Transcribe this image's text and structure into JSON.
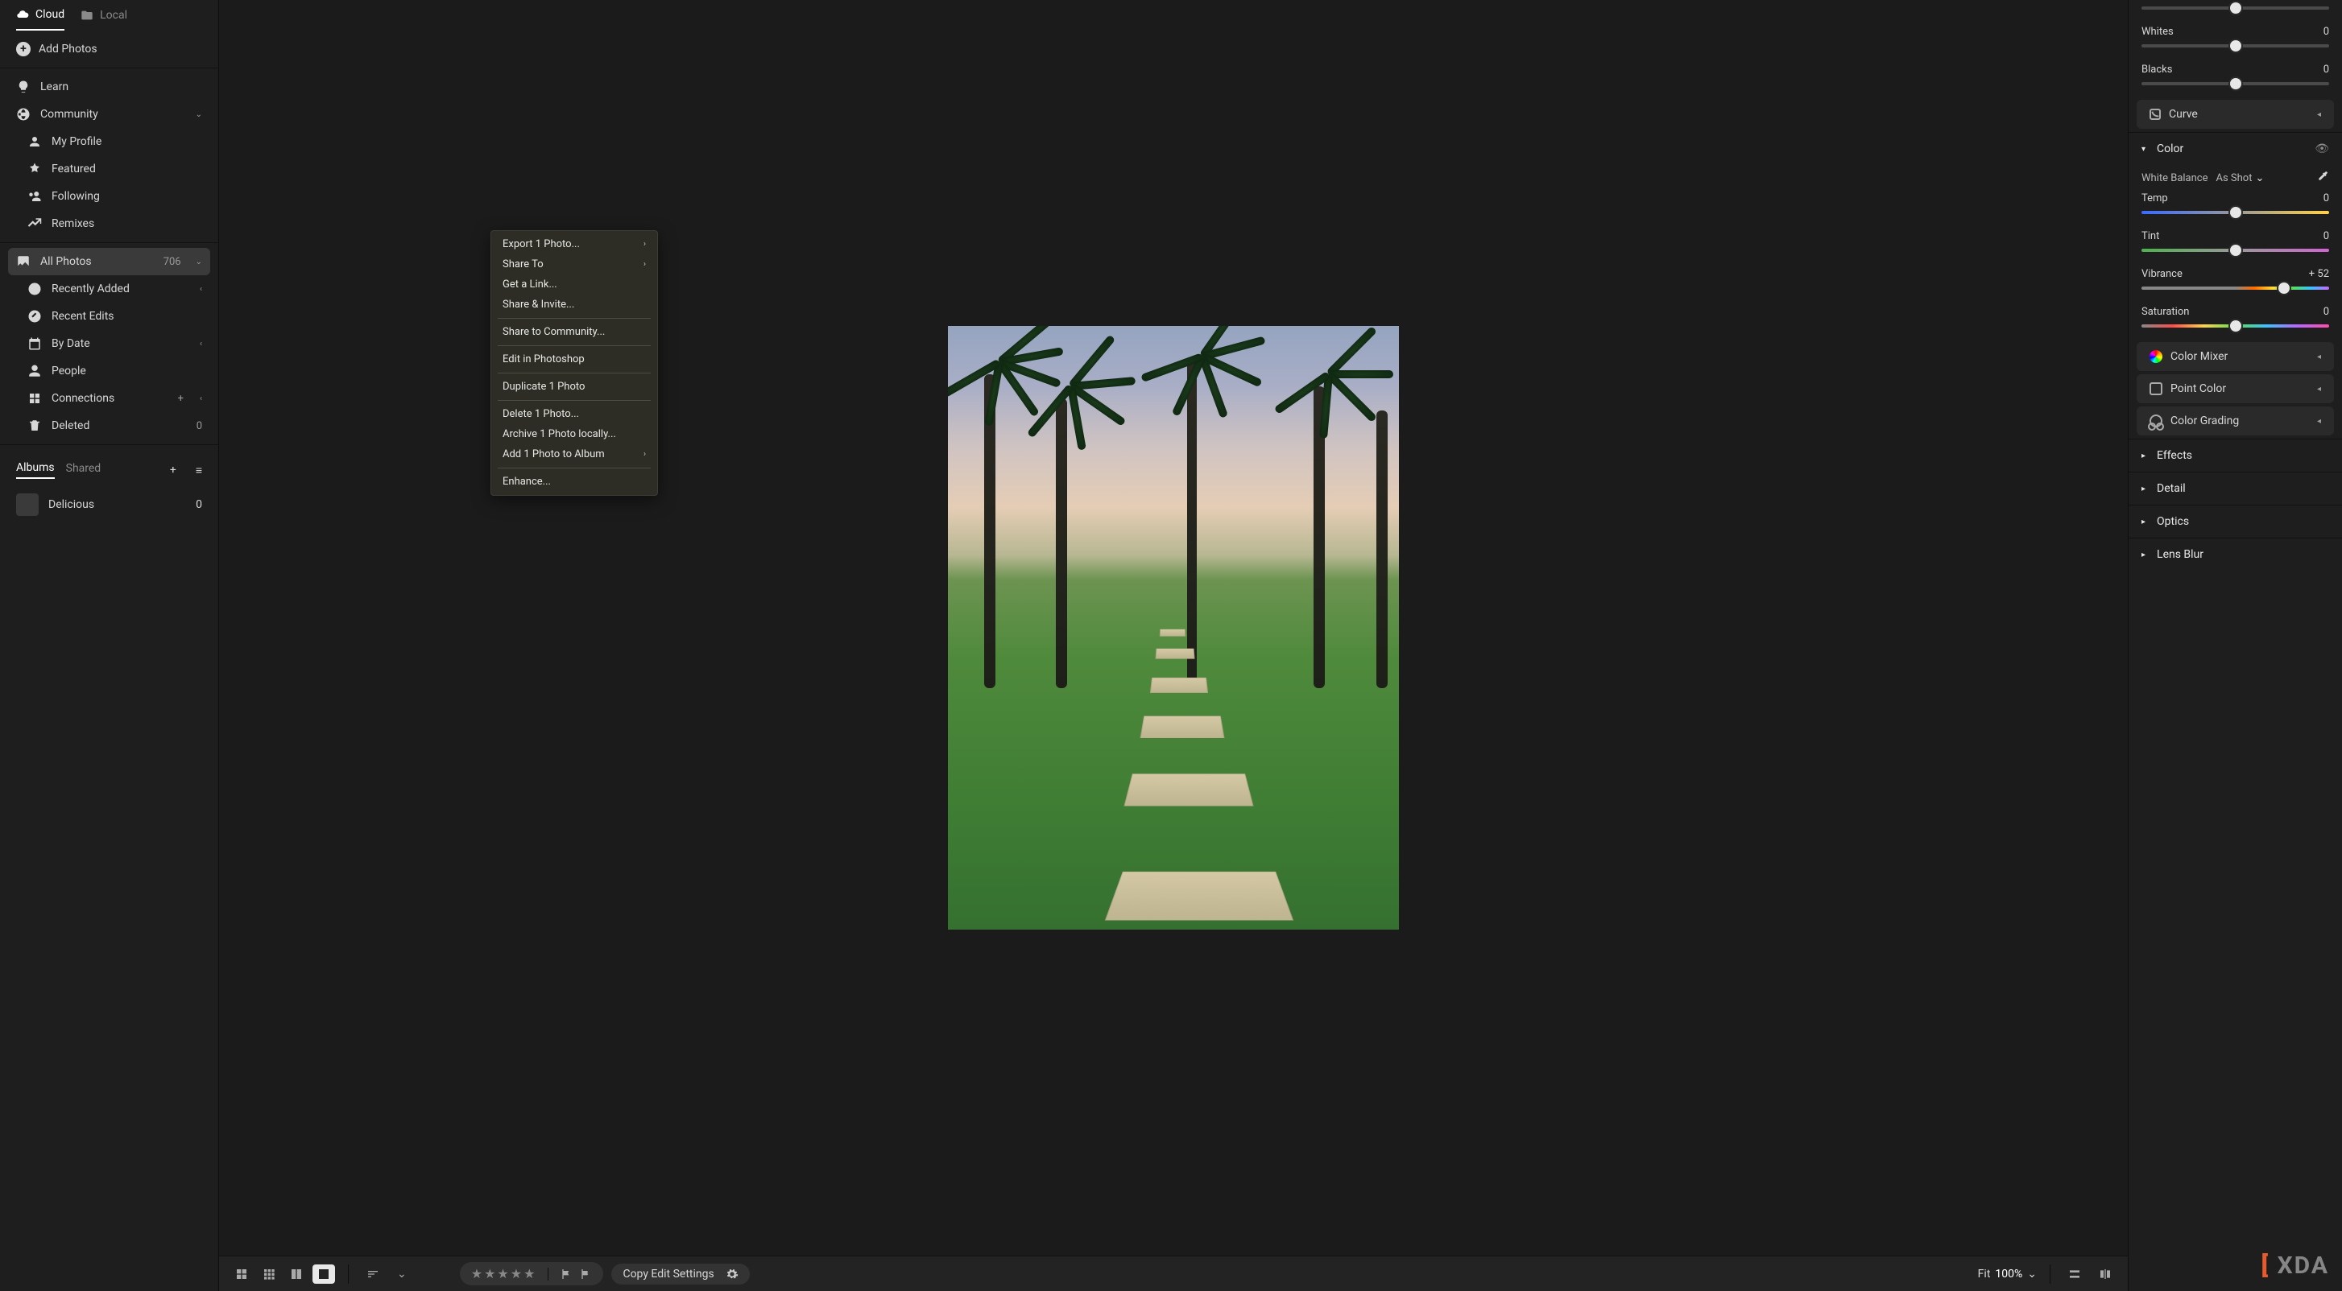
{
  "tabs": {
    "cloud": "Cloud",
    "local": "Local"
  },
  "add_photos": "Add Photos",
  "nav": {
    "learn": "Learn",
    "community": "Community",
    "my_profile": "My Profile",
    "featured": "Featured",
    "following": "Following",
    "remixes": "Remixes"
  },
  "library": {
    "all_photos": {
      "label": "All Photos",
      "count": "706"
    },
    "recently_added": "Recently Added",
    "recent_edits": "Recent Edits",
    "by_date": "By Date",
    "people": "People",
    "connections": "Connections",
    "deleted": {
      "label": "Deleted",
      "count": "0"
    }
  },
  "albums": {
    "tab_albums": "Albums",
    "tab_shared": "Shared",
    "items": [
      {
        "name": "Delicious",
        "count": "0"
      }
    ]
  },
  "context_menu": {
    "export": "Export 1 Photo...",
    "share_to": "Share To",
    "get_link": "Get a Link...",
    "share_invite": "Share & Invite...",
    "share_community": "Share to Community...",
    "edit_ps": "Edit in Photoshop",
    "duplicate": "Duplicate 1 Photo",
    "delete": "Delete 1 Photo...",
    "archive": "Archive 1 Photo locally...",
    "add_album": "Add 1 Photo to Album",
    "enhance": "Enhance..."
  },
  "bottombar": {
    "copy_edit": "Copy Edit Settings",
    "fit_label": "Fit",
    "zoom": "100%"
  },
  "right": {
    "whites": {
      "label": "Whites",
      "value": "0",
      "pos": 50
    },
    "blacks": {
      "label": "Blacks",
      "value": "0",
      "pos": 50
    },
    "curve": "Curve",
    "color_header": "Color",
    "wb_label": "White Balance",
    "wb_value": "As Shot",
    "temp": {
      "label": "Temp",
      "value": "0",
      "pos": 50
    },
    "tint": {
      "label": "Tint",
      "value": "0",
      "pos": 50
    },
    "vibrance": {
      "label": "Vibrance",
      "value": "+ 52",
      "pos": 76
    },
    "saturation": {
      "label": "Saturation",
      "value": "0",
      "pos": 50
    },
    "color_mixer": "Color Mixer",
    "point_color": "Point Color",
    "color_grading": "Color Grading",
    "effects": "Effects",
    "detail": "Detail",
    "optics": "Optics",
    "lens_blur": "Lens Blur"
  },
  "watermark": "XDA"
}
